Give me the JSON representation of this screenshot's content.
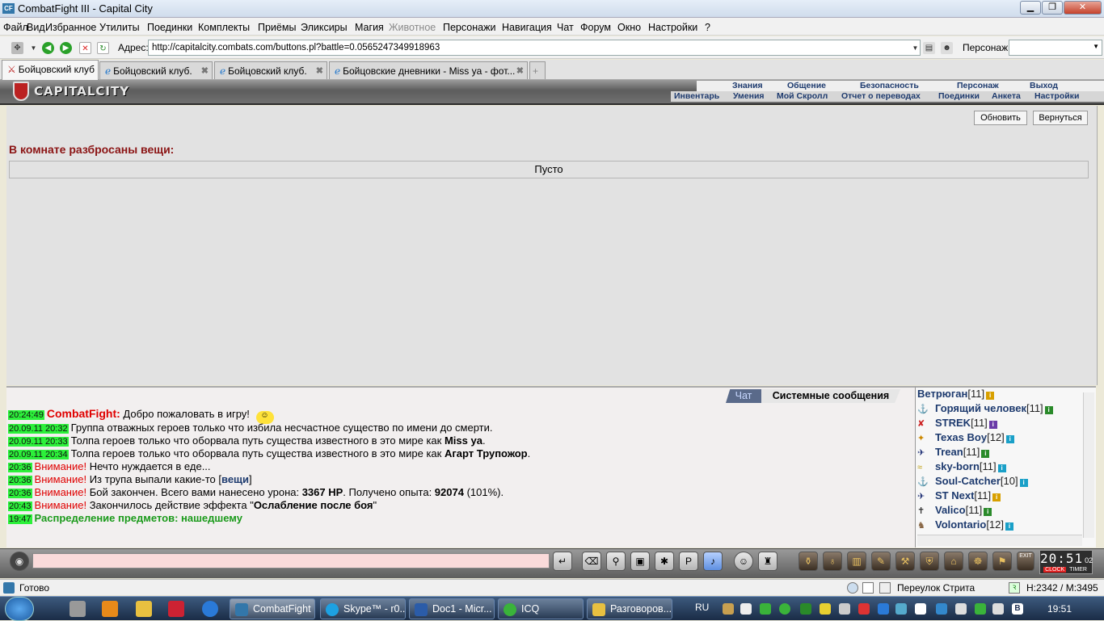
{
  "window": {
    "title": "CombatFight III - Capital City",
    "app_icon": "CF"
  },
  "menu": [
    "Файл",
    "Вид",
    "Избранное",
    "Утилиты",
    "Поединки",
    "Комплекты",
    "Приёмы",
    "Эликсиры",
    "Магия",
    "Животное",
    "Персонажи",
    "Навигация",
    "Чат",
    "Форум",
    "Окно",
    "Настройки",
    "?"
  ],
  "address": {
    "label": "Адрес:",
    "url": "http://capitalcity.combats.com/buttons.pl?battle=0.0565247349918963",
    "char_label": "Персонаж:"
  },
  "tabs": [
    {
      "label": "Бойцовский клуб",
      "active": true
    },
    {
      "label": "Бойцовский клуб.",
      "active": false
    },
    {
      "label": "Бойцовский клуб.",
      "active": false
    },
    {
      "label": "Бойцовские дневники - Miss ya - фот...",
      "active": false
    }
  ],
  "game": {
    "logo": "CAPITALCITY",
    "nav_top": [
      "Знания",
      "Общение",
      "Безопасность",
      "Персонаж",
      "Выход"
    ],
    "nav_bottom": [
      "Инвентарь",
      "Умения",
      "Мой Скролл",
      "Отчет о переводах",
      "Поединки",
      "Анкета",
      "Настройки"
    ],
    "refresh": "Обновить",
    "back": "Вернуться",
    "room_header": "В комнате разбросаны вещи:",
    "room_empty": "Пусто"
  },
  "chat": {
    "tab_chat": "Чат",
    "tab_system": "Системные сообщения",
    "messages": [
      {
        "time": "20:24:49",
        "prefix": "CombatFight:",
        "text": " Добро пожаловать в игру!"
      },
      {
        "time": "20.09.11 20:32",
        "prefix": "",
        "text": "Группа отважных героев только что избила несчастное существо по имени до смерти."
      },
      {
        "time": "20.09.11 20:33",
        "prefix": "",
        "text": "Толпа героев только что оборвала путь существа известного в это мире как ",
        "bold": "Miss ya",
        "after": "."
      },
      {
        "time": "20.09.11 20:34",
        "prefix": "",
        "text": "Толпа героев только что оборвала путь существа известного в это мире как ",
        "bold": "Агарт Трупожор",
        "after": "."
      },
      {
        "time": "20:36",
        "prefix": "Внимание!",
        "text": " Нечто нуждается в еде..."
      },
      {
        "time": "20:36",
        "prefix": "Внимание!",
        "text": " Из трупа выпали какие-то [",
        "bold": "вещи",
        "after": "]"
      },
      {
        "time": "20:36",
        "prefix": "Внимание!",
        "text": " Бой закончен. Всего вами нанесено урона: ",
        "bold": "3367 HP",
        "after": ". Получено опыта: ",
        "bold2": "92074",
        "after2": " (101%)."
      },
      {
        "time": "20:43",
        "prefix": "Внимание!",
        "text": " Закончилось действие эффекта \"",
        "bold": "Ослабление после боя",
        "after": "\""
      },
      {
        "time": "19:47",
        "prefix": "",
        "green": "Распределение предметов: нашедшему"
      }
    ]
  },
  "users": [
    {
      "name": "Ветрюган",
      "level": "[11]"
    },
    {
      "name": "Горящий человек",
      "level": "[11]"
    },
    {
      "name": "STREK",
      "level": "[11]"
    },
    {
      "name": "Texas Boy",
      "level": "[12]"
    },
    {
      "name": "Trean",
      "level": "[11]"
    },
    {
      "name": "sky-born",
      "level": "[11]"
    },
    {
      "name": "Soul-Catcher",
      "level": "[10]"
    },
    {
      "name": "ST Next",
      "level": "[11]"
    },
    {
      "name": "Valico",
      "level": "[11]"
    },
    {
      "name": "Volontario",
      "level": "[12]"
    }
  ],
  "clock": {
    "time": "20:51",
    "sec": "02",
    "clock_label": "CLOCK",
    "timer_label": "TIMER",
    "exit_label": "EXIT"
  },
  "status": {
    "ready": "Готово",
    "location": "Переулок Стрита",
    "hp_mp": "H:2342 / M:3495"
  },
  "taskbar": {
    "items": [
      "CombatFight",
      "Skype™ - r0...",
      "Doc1 - Micr...",
      "ICQ",
      "Разговоров..."
    ],
    "lang": "RU",
    "time": "19:51"
  },
  "colors": {
    "timestamp_bg": "#2cf03a",
    "warning_red": "#e00000",
    "nick_blue": "#1d3a6e",
    "room_header": "#8b1414",
    "system_green": "#1a9a1a"
  }
}
